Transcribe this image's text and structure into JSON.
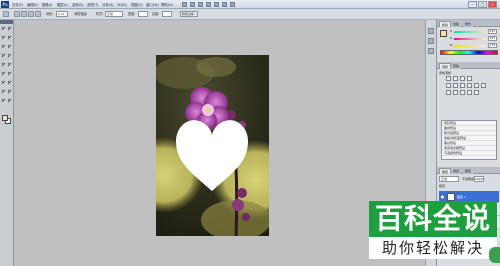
{
  "app": {
    "logo_text": "Ps",
    "menu": [
      "文件(F)",
      "编辑(E)",
      "图像(I)",
      "图层(L)",
      "选择(S)",
      "滤镜(T)",
      "分析(A)",
      "3D(D)",
      "视图(V)",
      "窗口(W)",
      "帮助(H)"
    ],
    "window_buttons": [
      "–",
      "□",
      "×"
    ]
  },
  "options_bar": {
    "feather_label": "羽化:",
    "feather_value": "0 px",
    "antialias_label": "消除锯齿",
    "style_label": "样式:",
    "style_value": "正常",
    "width_label": "宽度:",
    "height_label": "高度:",
    "refine_label": "调整边缘..."
  },
  "tools": {
    "names": [
      "move-tool",
      "marquee-tool",
      "lasso-tool",
      "quick-select-tool",
      "crop-tool",
      "eyedropper-tool",
      "healing-brush-tool",
      "brush-tool",
      "clone-stamp-tool",
      "history-brush-tool",
      "eraser-tool",
      "gradient-tool",
      "blur-tool",
      "dodge-tool",
      "pen-tool",
      "type-tool",
      "path-select-tool",
      "shape-tool"
    ],
    "foreground_color": "#f2e3b3",
    "background_color": "#ffffff"
  },
  "panels": {
    "color": {
      "tabs": [
        "颜色",
        "色板",
        "样式"
      ],
      "channels": [
        {
          "label": "R",
          "value": "242"
        },
        {
          "label": "G",
          "value": "227"
        },
        {
          "label": "B",
          "value": "179"
        }
      ]
    },
    "adjustments": {
      "tabs": [
        "调整",
        "蒙版"
      ],
      "title": "添加调整",
      "presets": [
        "色阶预设",
        "曲线预设",
        "曝光度预设",
        "色相/饱和度预设",
        "黑白预设",
        "通道混合器预设",
        "可选颜色预设"
      ]
    },
    "layers": {
      "tabs": [
        "图层",
        "通道",
        "路径"
      ],
      "blend_mode": "正常",
      "opacity_label": "不透明度:",
      "opacity_value": "100%",
      "lock_label": "锁定:",
      "items": [
        {
          "name": "图层 1"
        },
        {
          "name": "形状 1"
        },
        {
          "name": "背景"
        }
      ]
    }
  },
  "watermark": {
    "title": "百科全说",
    "subtitle": "助你轻松解决"
  }
}
